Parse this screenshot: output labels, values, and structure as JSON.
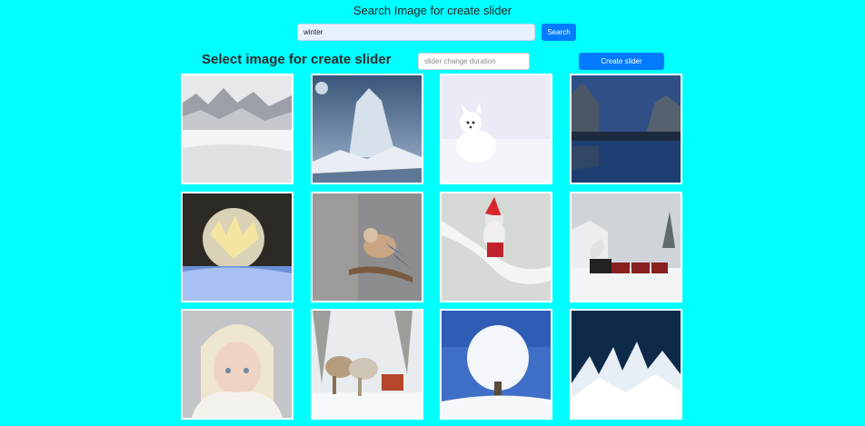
{
  "header": {
    "title": "Search Image for create slider"
  },
  "search": {
    "value": "winter",
    "button_label": "Search"
  },
  "gallery": {
    "title": "Select image for create slider",
    "duration_placeholder": "slider change duration",
    "create_label": "Create slider",
    "images": [
      {
        "name": "misty-mountain-snow-image"
      },
      {
        "name": "ice-sculpture-figure-image"
      },
      {
        "name": "arctic-fox-image"
      },
      {
        "name": "mountain-lake-image"
      },
      {
        "name": "frozen-bubble-image"
      },
      {
        "name": "jay-bird-on-branch-image"
      },
      {
        "name": "gnome-on-snowy-branch-image"
      },
      {
        "name": "steam-train-snow-image"
      },
      {
        "name": "woman-in-sweater-image"
      },
      {
        "name": "horse-sleigh-image"
      },
      {
        "name": "frosted-tree-image"
      },
      {
        "name": "ice-crystals-image"
      }
    ]
  },
  "colors": {
    "background": "#00ffff",
    "primary": "#007bff"
  }
}
